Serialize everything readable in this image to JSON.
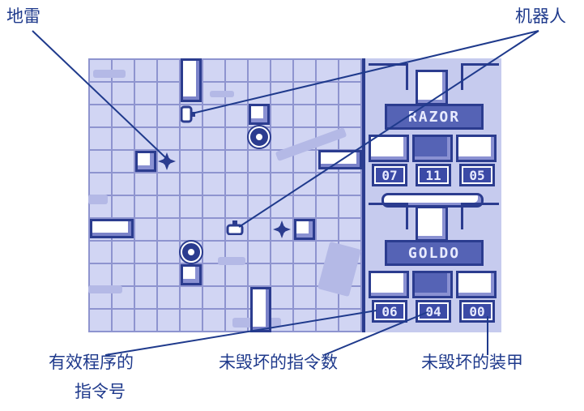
{
  "callouts": {
    "mine": "地雷",
    "robot": "机器人",
    "valid_program_line1": "有效程序的",
    "valid_program_line2": "指令号",
    "undestroyed_instructions": "未毁坏的指令数",
    "undestroyed_armor": "未毁坏的装甲"
  },
  "robots": [
    {
      "name": "RAZOR",
      "counters": [
        "07",
        "11",
        "05"
      ]
    },
    {
      "name": "GOLDO",
      "counters": [
        "06",
        "04",
        "00"
      ]
    }
  ],
  "icons": {
    "portrait": "robot-portrait-icon",
    "instructions": "instruction-chip-icon",
    "program": "program-chip-icon",
    "armor": "armor-plate-icon",
    "mine": "mine-icon",
    "robot": "robot-tank-icon"
  },
  "colors": {
    "annotation": "#1f3a8c",
    "outline": "#2b3c8f",
    "floor": "#d1d5f3",
    "namebar": "#5563b5"
  }
}
